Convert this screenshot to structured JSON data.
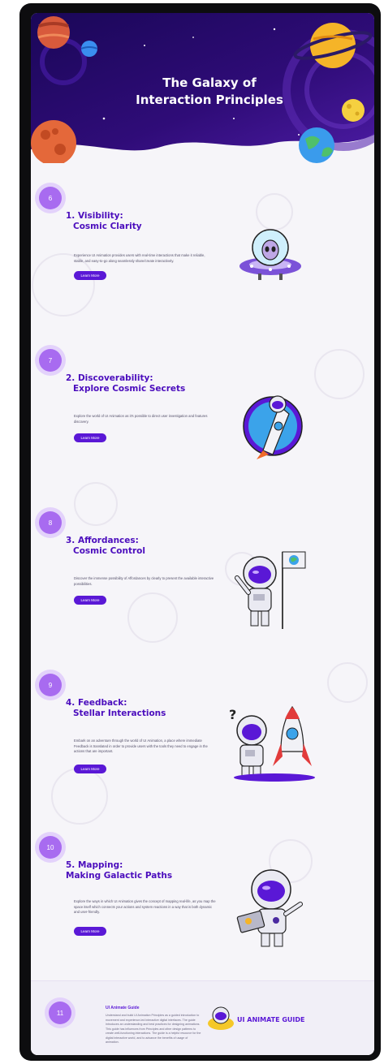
{
  "hero": {
    "title_line1": "The Galaxy of",
    "title_line2": "Interaction Principles"
  },
  "sections": [
    {
      "number": "6",
      "title_line1": "1. Visibility:",
      "title_line2": "Cosmic Clarity",
      "description": "Experience UI Animation provides users with real-time interactions that make it reliable, stable, and easy-to-go along seamlessly share/create interactively.",
      "button": "Learn More",
      "illustration": "alien-ufo"
    },
    {
      "number": "7",
      "title_line1": "2. Discoverability:",
      "title_line2": "Explore Cosmic Secrets",
      "description": "Explore the world of UI Animation as it's possible to direct user investigation and features discovery.",
      "button": "Learn More",
      "illustration": "astronaut-rocket"
    },
    {
      "number": "8",
      "title_line1": "3. Affordances:",
      "title_line2": "Cosmic Control",
      "description": "Discover the immense possibility of Affordances by clearly to present the available interactive possibilities.",
      "button": "Learn More",
      "illustration": "astronaut-flag"
    },
    {
      "number": "9",
      "title_line1": "4. Feedback:",
      "title_line2": "Stellar Interactions",
      "description": "Embark on an adventure through the world of UI Animation, a place where immediate Feedback is translated in order to provide users with the tools they need to engage in the actions that are important.",
      "button": "Learn More",
      "illustration": "astronaut-question-rocket"
    },
    {
      "number": "10",
      "title_line1": "5. Mapping:",
      "title_line2": "Making Galactic Paths",
      "description": "Explore the ways in which UI Animation gives the concept of mapping real-life, as you map the space itself which connects your actions and system reactions in a way that is both dynamic and user-friendly.",
      "button": "Learn More",
      "illustration": "astronaut-laptop"
    }
  ],
  "footer": {
    "number": "11",
    "title": "UI Animate Guide",
    "text": "Understand and build UI Animation Principles as a guided introduction to movement and experience-led interactive digital interfaces. The guide introduces an understanding and best practices for designing animations. This guide has influences from Principles and other design patterns to create well-functioning interactions. The guide is a helpful resource for the digital interactive world, and to advance the benefits of usage of animation.",
    "logo_text": "UI ANIMATE GUIDE"
  },
  "colors": {
    "hero_bg": "#2a0a6e",
    "accent": "#5a18d6",
    "heading": "#4b0dbd",
    "number_circle": "#a86bf0"
  }
}
